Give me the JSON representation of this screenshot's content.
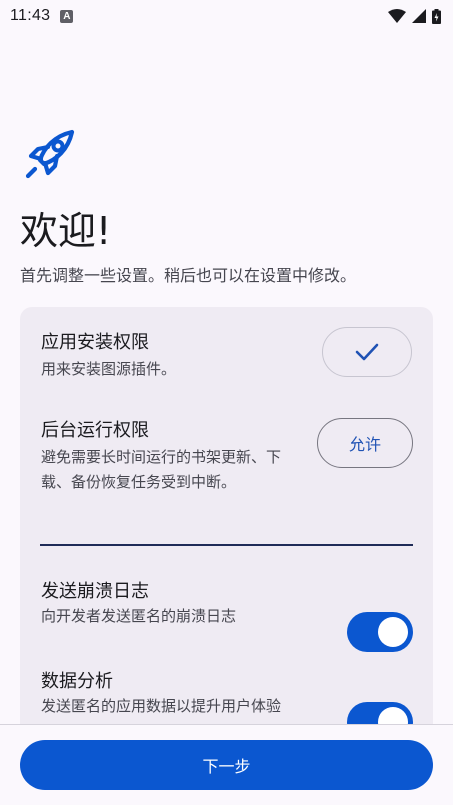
{
  "status_bar": {
    "time": "11:43",
    "notification_icon": "A"
  },
  "welcome": {
    "title": "欢迎!",
    "subtitle": "首先调整一些设置。稍后也可以在设置中修改。"
  },
  "permissions": [
    {
      "title": "应用安装权限",
      "description": "用来安装图源插件。",
      "state": "granted"
    },
    {
      "title": "后台运行权限",
      "description": "避免需要长时间运行的书架更新、下载、备份恢复任务受到中断。",
      "button_label": "允许"
    }
  ],
  "toggles": [
    {
      "title": "发送崩溃日志",
      "description": "向开发者发送匿名的崩溃日志",
      "enabled": true
    },
    {
      "title": "数据分析",
      "description": "发送匿名的应用数据以提升用户体验",
      "enabled": true
    }
  ],
  "footer": {
    "next_label": "下一步"
  },
  "colors": {
    "accent": "#0b57d0",
    "card": "#efebf3",
    "background": "#fbf8fd"
  }
}
